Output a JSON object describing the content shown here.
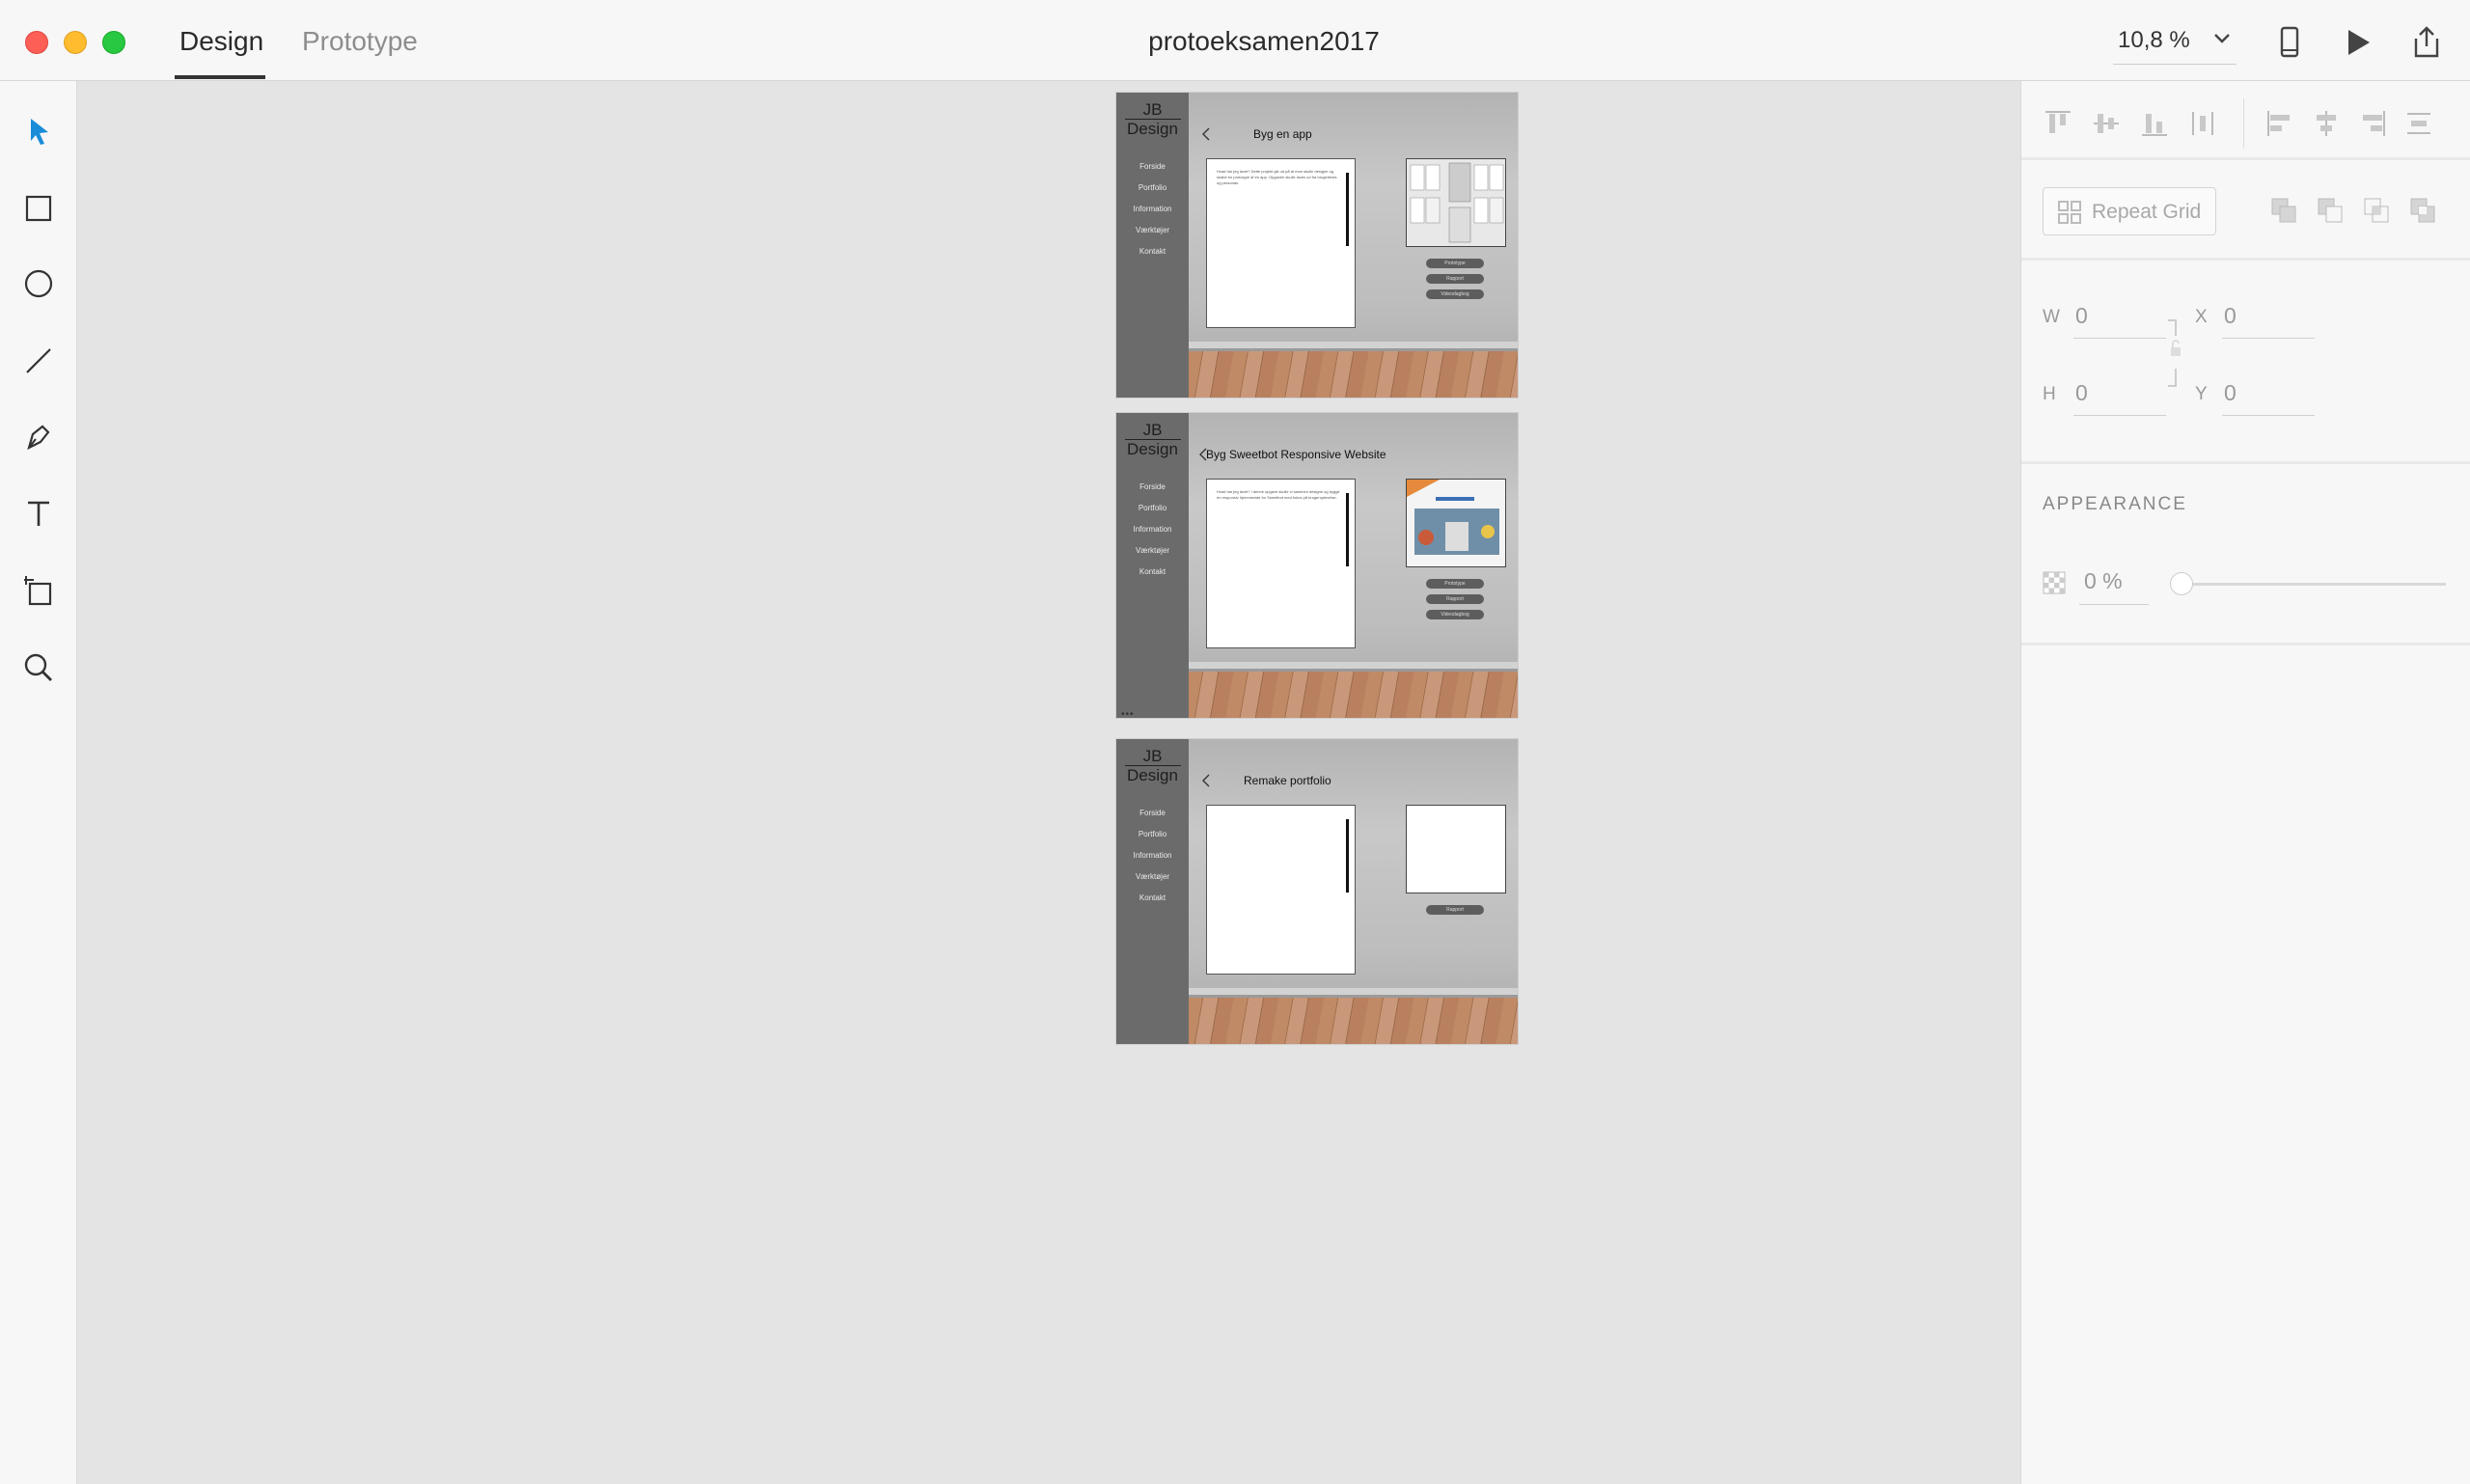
{
  "window": {
    "tabs": {
      "design": "Design",
      "prototype": "Prototype"
    },
    "document_title": "protoeksamen2017",
    "zoom_level": "10,8 %"
  },
  "toolbar": {
    "tools": [
      "select-tool",
      "rectangle-tool",
      "ellipse-tool",
      "line-tool",
      "pen-tool",
      "text-tool",
      "artboard-tool",
      "zoom-tool"
    ]
  },
  "artboards": [
    {
      "logo_top": "JB",
      "logo_bottom": "Design",
      "nav": [
        "Forside",
        "Portfolio",
        "Information",
        "Værktøjer",
        "Kontakt"
      ],
      "title": "Byg en app",
      "doc_text": "Hvad har jeg lavet? Dette projekt gik ud på at man skulle designe og skabe en prototype af en app. Opgaven skulle laves ud fra brugertests og personas.",
      "buttons": [
        "Prototype",
        "Rapport",
        "Videodagbog"
      ],
      "thumb": "app-screens"
    },
    {
      "logo_top": "JB",
      "logo_bottom": "Design",
      "nav": [
        "Forside",
        "Portfolio",
        "Information",
        "Værktøjer",
        "Kontakt"
      ],
      "title": "Byg Sweetbot Responsive Website",
      "doc_text": "Hvad har jeg lavet? I denne opgave skulle vi sammen designe og bygge en responsiv hjemmeside for Sweetbot med fokus på brugeroplevelse.",
      "buttons": [
        "Prototype",
        "Rapport",
        "Videodagbog"
      ],
      "thumb": "website"
    },
    {
      "logo_top": "JB",
      "logo_bottom": "Design",
      "nav": [
        "Forside",
        "Portfolio",
        "Information",
        "Værktøjer",
        "Kontakt"
      ],
      "title": "Remake portfolio",
      "doc_text": "",
      "buttons": [
        "Rapport"
      ],
      "thumb": "blank"
    }
  ],
  "inspector": {
    "repeat_grid": "Repeat Grid",
    "w_label": "W",
    "w_value": "0",
    "h_label": "H",
    "h_value": "0",
    "x_label": "X",
    "x_value": "0",
    "y_label": "Y",
    "y_value": "0",
    "appearance": "APPEARANCE",
    "opacity": "0 %"
  },
  "colors": {
    "accent": "#1a8cd8",
    "traffic_red": "#fd5f57",
    "traffic_yellow": "#febc2e",
    "traffic_green": "#28c840"
  }
}
